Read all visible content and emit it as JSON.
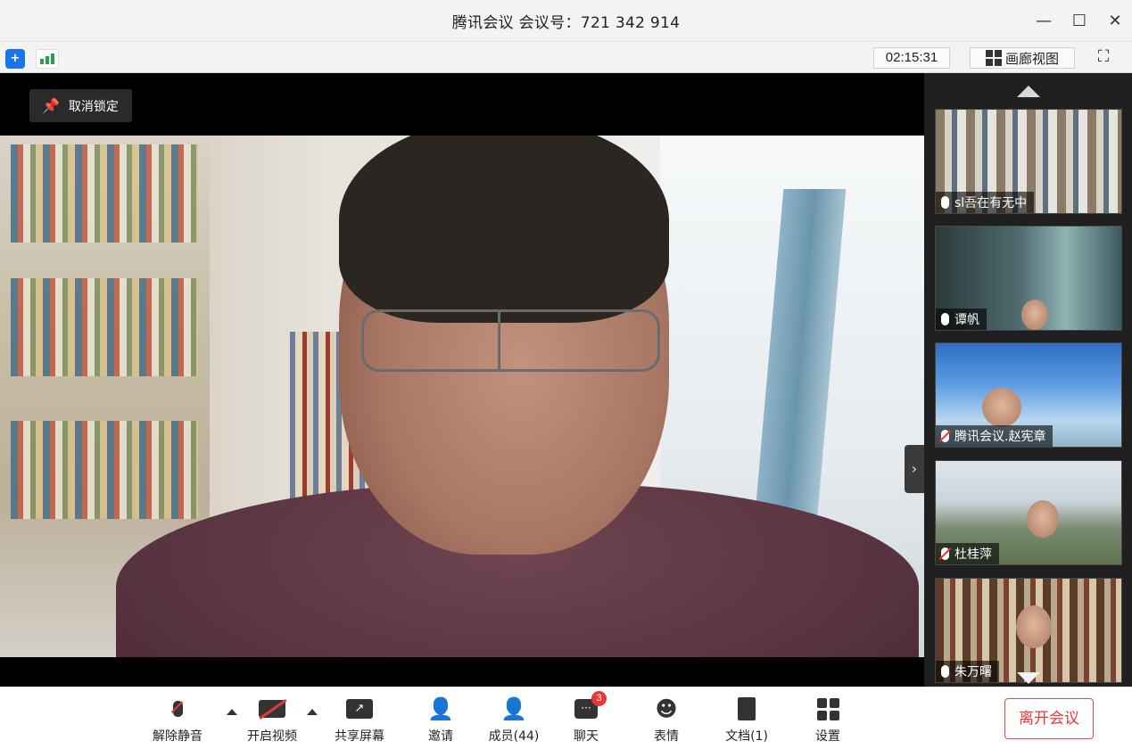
{
  "window": {
    "title": "腾讯会议 会议号：721 342 914",
    "minimize_icon": "minimize-icon",
    "maximize_icon": "maximize-icon",
    "close_icon": "close-icon"
  },
  "statusbar": {
    "timer": "02:15:31",
    "gallery_label": "画廊视图",
    "security_icon": "shield-icon",
    "signal_icon": "signal-icon",
    "fullscreen_icon": "fullscreen-icon"
  },
  "main": {
    "unlock_label": "取消锁定"
  },
  "sidebar": {
    "participants": [
      {
        "name": "sl吾在有无中",
        "muted": false
      },
      {
        "name": "谭帆",
        "muted": false
      },
      {
        "name": "腾讯会议.赵宪章",
        "muted": true
      },
      {
        "name": "杜桂萍",
        "muted": true
      },
      {
        "name": "朱万曙",
        "muted": false
      }
    ]
  },
  "toolbar": {
    "unmute_label": "解除静音",
    "video_label": "开启视频",
    "share_label": "共享屏幕",
    "invite_label": "邀请",
    "members_label": "成员(44)",
    "chat_label": "聊天",
    "chat_badge": "3",
    "emoji_label": "表情",
    "docs_label": "文档(1)",
    "settings_label": "设置",
    "leave_label": "离开会议"
  },
  "colors": {
    "accent": "#1a73e8",
    "danger": "#e53935",
    "signal": "#2aa146"
  }
}
